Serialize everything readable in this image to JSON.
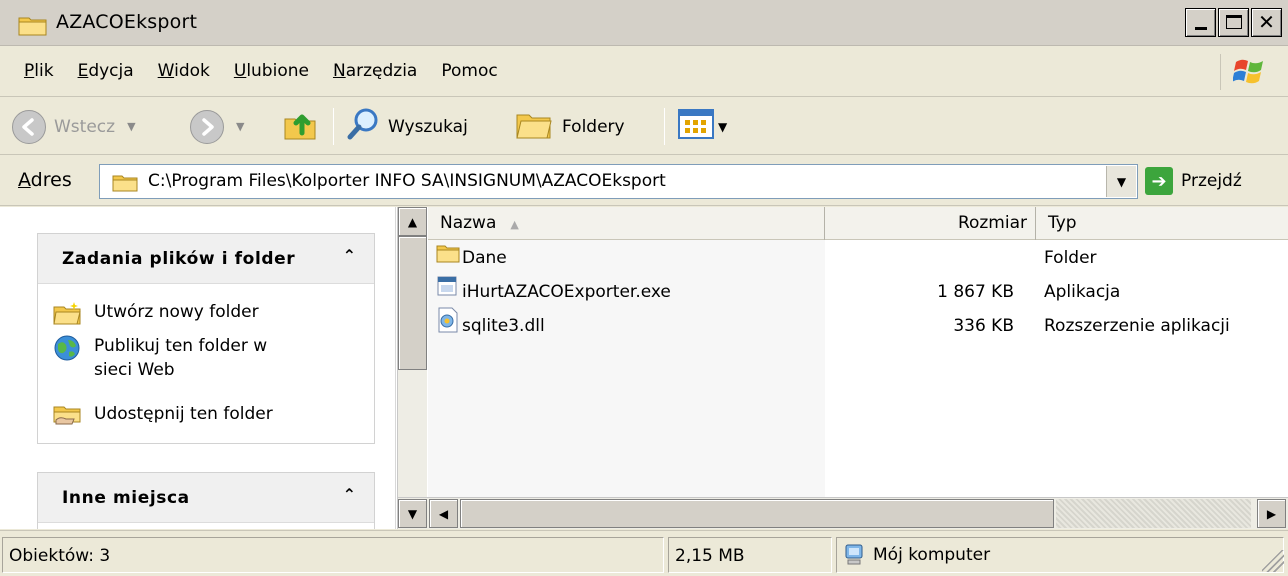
{
  "window": {
    "title": "AZACOEksport"
  },
  "menu": {
    "items": [
      {
        "key": "P",
        "rest": "lik"
      },
      {
        "key": "E",
        "rest": "dycja"
      },
      {
        "key": "W",
        "rest": "idok"
      },
      {
        "key": "U",
        "rest": "lubione"
      },
      {
        "key": "N",
        "rest": "arzędzia"
      },
      {
        "key": "",
        "rest": "Pomoc"
      }
    ]
  },
  "toolbar": {
    "back_label": "Wstecz",
    "search_label": "Wyszukaj",
    "folders_label": "Foldery"
  },
  "address": {
    "label": "Adres",
    "path": "C:\\Program Files\\Kolporter INFO SA\\INSIGNUM\\AZACOEksport",
    "go_label": "Przejdź"
  },
  "taskpane": {
    "file_tasks_title": "Zadania plików i folder",
    "tasks": [
      {
        "label": "Utwórz nowy folder"
      },
      {
        "label": "Publikuj ten folder w sieci Web"
      },
      {
        "label": "Udostępnij ten folder"
      }
    ],
    "other_places_title": "Inne miejsca"
  },
  "filelist": {
    "columns": {
      "name": "Nazwa",
      "size": "Rozmiar",
      "type": "Typ"
    },
    "rows": [
      {
        "name": "Dane",
        "size": "",
        "type": "Folder"
      },
      {
        "name": "iHurtAZACOExporter.exe",
        "size": "1 867 KB",
        "type": "Aplikacja"
      },
      {
        "name": "sqlite3.dll",
        "size": "336 KB",
        "type": "Rozszerzenie aplikacji"
      }
    ]
  },
  "status": {
    "objects": "Obiektów: 3",
    "size": "2,15 MB",
    "location": "Mój komputer"
  },
  "colors": {
    "chrome": "#ece9d8",
    "title": "#d4d0c8",
    "folder": "#f3c84c",
    "go": "#3ca53c"
  }
}
